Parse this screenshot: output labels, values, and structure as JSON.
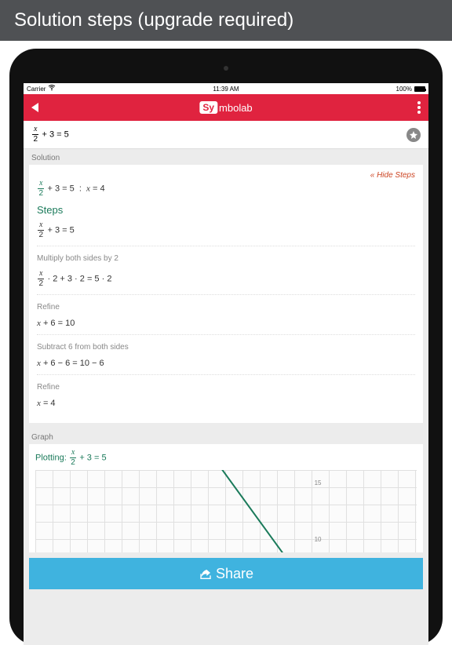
{
  "banner": {
    "text": "Solution steps (upgrade required)"
  },
  "status": {
    "carrier": "Carrier",
    "time": "11:39 AM",
    "battery": "100%"
  },
  "header": {
    "brand_prefix": "Sy",
    "brand_suffix": "mbolab"
  },
  "input": {
    "equation_html": "x/2 + 3 = 5"
  },
  "solution": {
    "section_label": "Solution",
    "hide_link": "« Hide Steps",
    "answer_prefix": "x/2 + 3 = 5",
    "answer_sep": ":",
    "answer_result": "x = 4",
    "steps_title": "Steps",
    "original": "x/2 + 3 = 5",
    "steps": [
      {
        "desc": "Multiply both sides by 2",
        "expr": "x/2 · 2 + 3 · 2 = 5 · 2"
      },
      {
        "desc": "Refine",
        "expr": "x + 6 = 10"
      },
      {
        "desc": "Subtract 6 from both sides",
        "expr": "x + 6 − 6 = 10 − 6"
      },
      {
        "desc": "Refine",
        "expr": "x = 4"
      }
    ]
  },
  "graph": {
    "section_label": "Graph",
    "plotting_label": "Plotting:",
    "plotting_expr": "x/2 + 3 = 5",
    "ticks": {
      "t1": "15",
      "t2": "10"
    }
  },
  "share": {
    "label": "Share"
  }
}
